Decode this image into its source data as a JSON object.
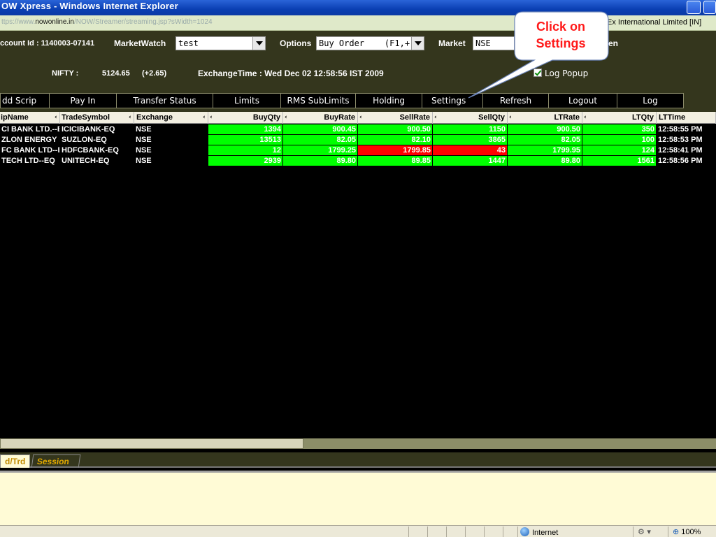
{
  "window": {
    "title": "OW Xpress - Windows Internet Explorer"
  },
  "address_bar": {
    "url_prefix": "ttps://www.",
    "url_domain": "nowonline.in",
    "url_path": "/NOW/Streamer/streaming.jsp?sWidth=1024",
    "certificate": "Ex International Limited [IN]"
  },
  "panel": {
    "account_label": "ccount Id : 1140003-07141",
    "marketwatch_label": "MarketWatch",
    "marketwatch_value": "test",
    "options_label": "Options",
    "options_value": "Buy Order    (F1,+)",
    "market_label": "Market",
    "market_value": "NSE",
    "screen_fragment": "en",
    "index_name": "NIFTY :",
    "index_value": "5124.65",
    "index_change": "(+2.65)",
    "exchange_time": "ExchangeTime : Wed Dec 02 12:58:56 IST 2009",
    "log_popup_label": "Log Popup",
    "log_popup_checked": true
  },
  "callout": {
    "line1": "Click on",
    "line2": "Settings",
    "color": "#ff1a1a"
  },
  "menu": {
    "add_scrip": "dd Scrip",
    "pay_in": "Pay In",
    "transfer_status": "Transfer Status",
    "limits": "Limits",
    "rms_sublimits": "RMS SubLimits",
    "holding": "Holding",
    "settings": "Settings",
    "refresh": "Refresh",
    "logout": "Logout",
    "log": "Log"
  },
  "grid": {
    "headers": [
      "ipName",
      "TradeSymbol",
      "Exchange",
      "BuyQty",
      "BuyRate",
      "SellRate",
      "SellQty",
      "LTRate",
      "LTQty",
      "LTTime"
    ],
    "rows": [
      {
        "scrip": "CI BANK LTD.--E",
        "symbol": "ICICIBANK-EQ",
        "exchange": "NSE",
        "buyqty": "1394",
        "buyrate": "900.45",
        "sellrate": "900.50",
        "sellqty": "1150",
        "ltrate": "900.50",
        "ltqty": "350",
        "lttime": "12:58:55 PM"
      },
      {
        "scrip": "ZLON ENERGY L",
        "symbol": "SUZLON-EQ",
        "exchange": "NSE",
        "buyqty": "13513",
        "buyrate": "82.05",
        "sellrate": "82.10",
        "sellqty": "3865",
        "ltrate": "82.05",
        "ltqty": "100",
        "lttime": "12:58:53 PM"
      },
      {
        "scrip": "FC BANK LTD--E",
        "symbol": "HDFCBANK-EQ",
        "exchange": "NSE",
        "buyqty": "12",
        "buyrate": "1799.25",
        "sellrate": "1799.85",
        "sellqty": "43",
        "ltrate": "1799.95",
        "ltqty": "124",
        "lttime": "12:58:41 PM"
      },
      {
        "scrip": "TECH LTD--EQ",
        "symbol": "UNITECH-EQ",
        "exchange": "NSE",
        "buyqty": "2939",
        "buyrate": "89.80",
        "sellrate": "89.85",
        "sellqty": "1447",
        "ltrate": "89.80",
        "ltqty": "1561",
        "lttime": "12:58:56 PM"
      }
    ],
    "colors": {
      "green": "#00ff00",
      "red": "#ff0000",
      "dark": "#000000"
    }
  },
  "tabs": {
    "ord_trd": "d/Trd",
    "session": "Session"
  },
  "statusbar": {
    "zone": "Internet",
    "zoom": "100%"
  }
}
